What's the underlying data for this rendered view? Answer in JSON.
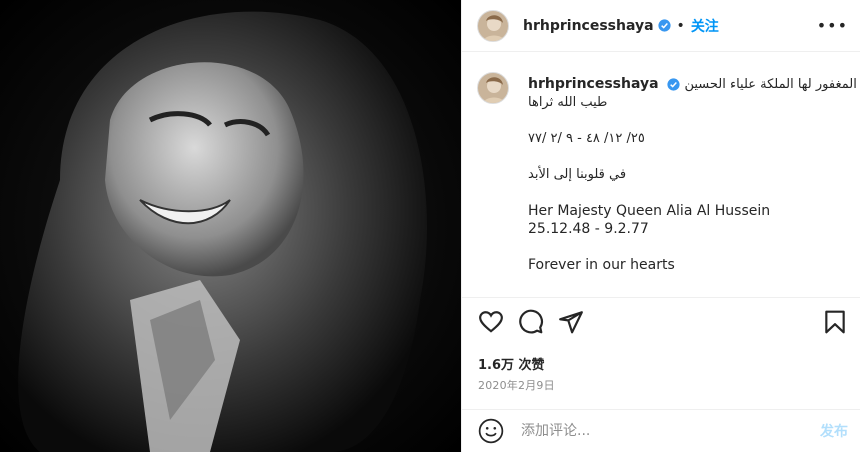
{
  "photo": {
    "alt_subject": "portrait"
  },
  "header": {
    "username": "hrhprincesshaya",
    "separator": "•",
    "follow_label": "关注",
    "more_label": "•••"
  },
  "caption": {
    "username": "hrhprincesshaya",
    "lines": [
      "جلالة المغفور لها الملكة علياء الحسين",
      "طيب الله ثراها",
      "",
      "٢٥/ ١٢/ ٤٨ - ٩ /٢ /٧٧",
      "",
      "في قلوبنا إلى الأبد",
      "",
      "Her Majesty Queen Alia Al Hussein",
      "25.12.48 - 9.2.77",
      "",
      "Forever in our hearts"
    ]
  },
  "actions": {
    "like_icon": "heart-icon",
    "comment_icon": "comment-icon",
    "share_icon": "share-icon",
    "save_icon": "bookmark-icon"
  },
  "likes": "1.6万 次赞",
  "date": "2020年2月9日",
  "comment": {
    "placeholder": "添加评论...",
    "post_label": "发布"
  },
  "colors": {
    "accent": "#0095f6",
    "post_disabled": "#b2dffc",
    "muted": "#8e8e8e"
  }
}
